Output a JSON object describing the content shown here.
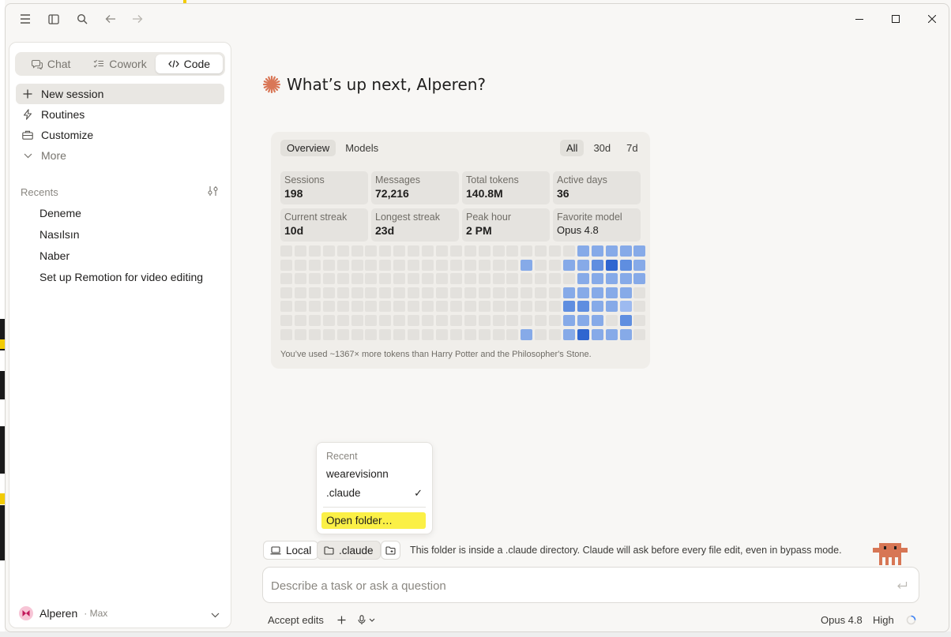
{
  "sidebar": {
    "modes": [
      {
        "label": "Chat",
        "icon": "chat-bubble-icon"
      },
      {
        "label": "Cowork",
        "icon": "checklist-icon"
      },
      {
        "label": "Code",
        "icon": "code-brackets-icon"
      }
    ],
    "active_mode": "Code",
    "nav": {
      "new_session": "New session",
      "routines": "Routines",
      "customize": "Customize",
      "more": "More"
    },
    "recents_label": "Recents",
    "recents": [
      "Deneme",
      "Nasılsın",
      "Naber",
      "Set up Remotion for video editing"
    ],
    "user": {
      "name": "Alperen",
      "plan": "· Max"
    }
  },
  "main": {
    "greeting": "What’s up next, Alperen?",
    "stats": {
      "tabs": [
        "Overview",
        "Models"
      ],
      "active_tab": "Overview",
      "ranges": [
        "All",
        "30d",
        "7d"
      ],
      "active_range": "All",
      "cards": [
        {
          "label": "Sessions",
          "value": "198"
        },
        {
          "label": "Messages",
          "value": "72,216"
        },
        {
          "label": "Total tokens",
          "value": "140.8M"
        },
        {
          "label": "Active days",
          "value": "36"
        },
        {
          "label": "Current streak",
          "value": "10d"
        },
        {
          "label": "Longest streak",
          "value": "23d"
        },
        {
          "label": "Peak hour",
          "value": "2 PM"
        },
        {
          "label": "Favorite model",
          "value": "Opus 4.8"
        }
      ],
      "heatmap_colors": {
        "empty": "#e3e1dd",
        "l1": "#9dbaf0",
        "l2": "#86aae8",
        "l3": "#5f8ee0",
        "l4": "#2f66d0"
      },
      "heatmap_active": [
        [
          0,
          21,
          2
        ],
        [
          0,
          22,
          2
        ],
        [
          0,
          23,
          2
        ],
        [
          0,
          24,
          2
        ],
        [
          0,
          25,
          2
        ],
        [
          1,
          17,
          2
        ],
        [
          1,
          20,
          2
        ],
        [
          1,
          21,
          2
        ],
        [
          1,
          22,
          3
        ],
        [
          1,
          23,
          4
        ],
        [
          1,
          24,
          3
        ],
        [
          1,
          25,
          2
        ],
        [
          2,
          21,
          2
        ],
        [
          2,
          22,
          2
        ],
        [
          2,
          23,
          2
        ],
        [
          2,
          24,
          2
        ],
        [
          2,
          25,
          2
        ],
        [
          3,
          20,
          2
        ],
        [
          3,
          21,
          2
        ],
        [
          3,
          22,
          2
        ],
        [
          3,
          23,
          2
        ],
        [
          3,
          24,
          2
        ],
        [
          4,
          20,
          3
        ],
        [
          4,
          21,
          3
        ],
        [
          4,
          22,
          2
        ],
        [
          4,
          23,
          2
        ],
        [
          4,
          24,
          1
        ],
        [
          5,
          20,
          2
        ],
        [
          5,
          21,
          2
        ],
        [
          5,
          22,
          2
        ],
        [
          5,
          24,
          3
        ],
        [
          6,
          17,
          2
        ],
        [
          6,
          20,
          2
        ],
        [
          6,
          21,
          4
        ],
        [
          6,
          22,
          2
        ],
        [
          6,
          23,
          2
        ],
        [
          6,
          24,
          2
        ]
      ],
      "footnote": "You’ve used ~1367× more tokens than Harry Potter and the Philosopher's Stone."
    },
    "folder_menu": {
      "header": "Recent",
      "items": [
        "wearevisionn",
        ".claude"
      ],
      "selected": ".claude",
      "check": "✓",
      "open_folder": "Open folder…",
      "highlight_color": "#fbf046"
    },
    "env_chip": "Local",
    "folder_chip": ".claude",
    "folder_note": "This folder is inside a .claude directory. Claude will ask before every file edit, even in bypass mode.",
    "input_placeholder": "Describe a task or ask a question",
    "bottom": {
      "accept_edits": "Accept edits",
      "model": "Opus 4.8",
      "effort": "High"
    }
  },
  "colors": {
    "accent": "#d97757",
    "mascot": "#d77655"
  }
}
